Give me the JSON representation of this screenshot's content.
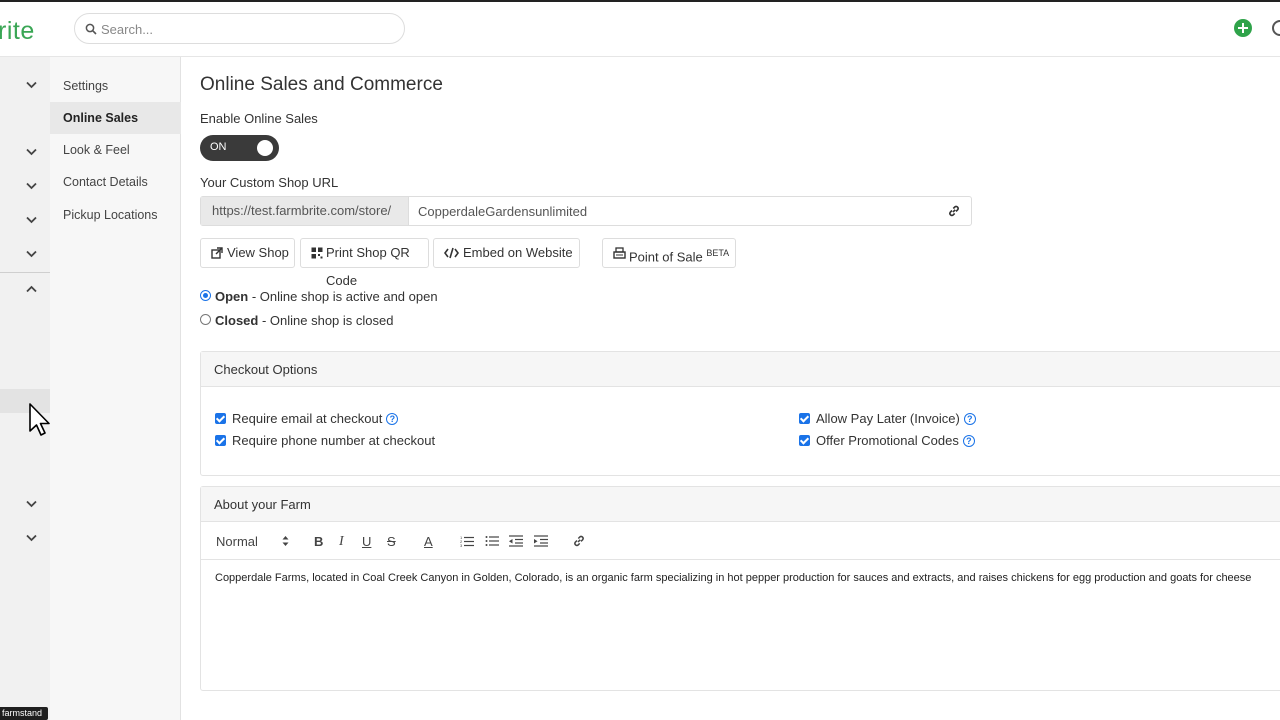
{
  "app": {
    "logo_text": "rite"
  },
  "search": {
    "placeholder": "Search..."
  },
  "sidebar": {
    "items": [
      {
        "label": "Settings"
      },
      {
        "label": "Online Sales"
      },
      {
        "label": "Look & Feel"
      },
      {
        "label": "Contact Details"
      },
      {
        "label": "Pickup Locations"
      }
    ],
    "footer_tag": "farmstand"
  },
  "main": {
    "title": "Online Sales and Commerce",
    "enable_label": "Enable Online Sales",
    "toggle_state": "ON",
    "url_label": "Your Custom Shop URL",
    "url_prefix": "https://test.farmbrite.com/store/",
    "url_value": "CopperdaleGardensunlimited",
    "buttons": {
      "view_shop": "View Shop",
      "print_qr": "Print Shop QR Code",
      "embed": "Embed on Website",
      "pos": "Point of Sale",
      "pos_badge": "BETA"
    },
    "status": {
      "open_label": "Open",
      "open_desc": " - Online shop is active and open",
      "closed_label": "Closed",
      "closed_desc": " - Online shop is closed",
      "selected": "Open"
    },
    "checkout": {
      "title": "Checkout Options",
      "require_email": "Require email at checkout",
      "require_phone": "Require phone number at checkout",
      "pay_later": "Allow Pay Later (Invoice)",
      "promo_codes": "Offer Promotional Codes"
    },
    "about": {
      "title": "About your Farm",
      "format_select": "Normal",
      "body": "Copperdale Farms, located in Coal Creek Canyon in Golden, Colorado, is an organic farm specializing in hot pepper production for sauces and extracts, and raises chickens for egg production and goats for cheese"
    }
  },
  "colors": {
    "brand": "#3aa655",
    "accent": "#1a73e8",
    "toggle_bg": "#3a3a3a"
  }
}
